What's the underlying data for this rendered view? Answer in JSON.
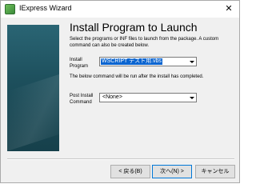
{
  "window": {
    "title": "IExpress Wizard",
    "close_glyph": "✕"
  },
  "page": {
    "heading": "Install Program to Launch",
    "description": "Select the programs or INF files to launch from the package.  A custom command can also be created below.",
    "install_program_label": "Install\nProgram",
    "install_program_value": "WSCRIPT テスト用.vbs",
    "post_note": "The below command will be run after the install has completed.",
    "post_install_label": "Post Install\nCommand",
    "post_install_value": "<None>"
  },
  "buttons": {
    "back": "< 戻る(B)",
    "next": "次へ(N) >",
    "cancel": "キャンセル"
  },
  "colors": {
    "selection": "#0a64d0",
    "banner": "#1d4f5c"
  }
}
